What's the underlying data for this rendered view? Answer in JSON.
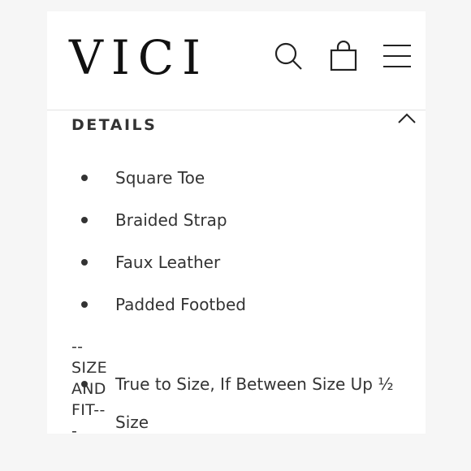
{
  "brand": {
    "logo_text": "VICI"
  },
  "header_icons": [
    "search-icon",
    "shopping-bag-icon",
    "menu-icon"
  ],
  "details": {
    "title": "DETAILS",
    "bullets": [
      "Square Toe",
      "Braided Strap",
      "Faux Leather",
      "Padded Footbed"
    ],
    "size_fit_label": "--SIZE AND FIT---",
    "size_fit_bullets": [
      {
        "line1": "True to Size, If Between Size Up ½",
        "line2": "Size"
      }
    ]
  },
  "colors": {
    "text": "#333333",
    "logo": "#111111",
    "divider": "#e2e2e2",
    "background": "#ffffff"
  }
}
